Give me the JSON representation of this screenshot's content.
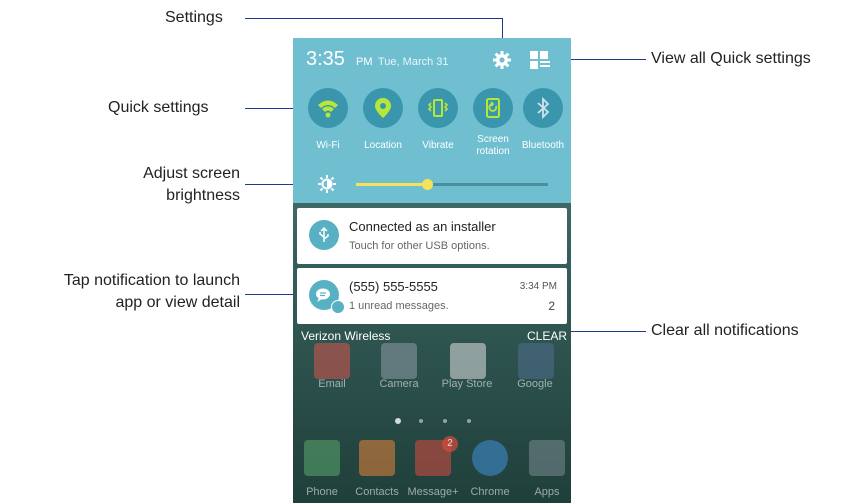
{
  "callouts": {
    "settings": "Settings",
    "view_all": "View all Quick settings",
    "quick_settings": "Quick settings",
    "brightness_line1": "Adjust screen",
    "brightness_line2": "brightness",
    "notification_line1": "Tap notification to launch",
    "notification_line2": "app or view detail",
    "clear_all": "Clear all notifications"
  },
  "status": {
    "time": "3:35",
    "ampm": "PM",
    "date": "Tue, March 31"
  },
  "quick_settings": [
    {
      "label": "Wi-Fi",
      "icon": "wifi-icon"
    },
    {
      "label": "Location",
      "icon": "location-icon"
    },
    {
      "label": "Vibrate",
      "icon": "vibrate-icon"
    },
    {
      "label_line1": "Screen",
      "label_line2": "rotation",
      "icon": "screen-rotation-icon"
    },
    {
      "label": "Bluetooth",
      "icon": "bluetooth-icon"
    }
  ],
  "brightness": {
    "level": 0.37
  },
  "notifications": [
    {
      "title": "Connected as an installer",
      "subtitle": "Touch for other USB options.",
      "icon": "usb-icon"
    },
    {
      "title": "(555) 555-5555",
      "subtitle": "1 unread messages.",
      "time": "3:34 PM",
      "count": "2",
      "icon": "message-icon"
    }
  ],
  "carrier": "Verizon Wireless",
  "clear_label": "CLEAR",
  "home_row": [
    "Email",
    "Camera",
    "Play Store",
    "Google"
  ],
  "dock": [
    "Phone",
    "Contacts",
    "Message+",
    "Chrome",
    "Apps"
  ],
  "message_badge": "2",
  "colors": {
    "panel": "#6fbfd1",
    "toggle_bg": "#3a96ad",
    "active_icon": "#b7e63a",
    "brightness": "#f5e25a",
    "leader": "#1f3a8a"
  }
}
